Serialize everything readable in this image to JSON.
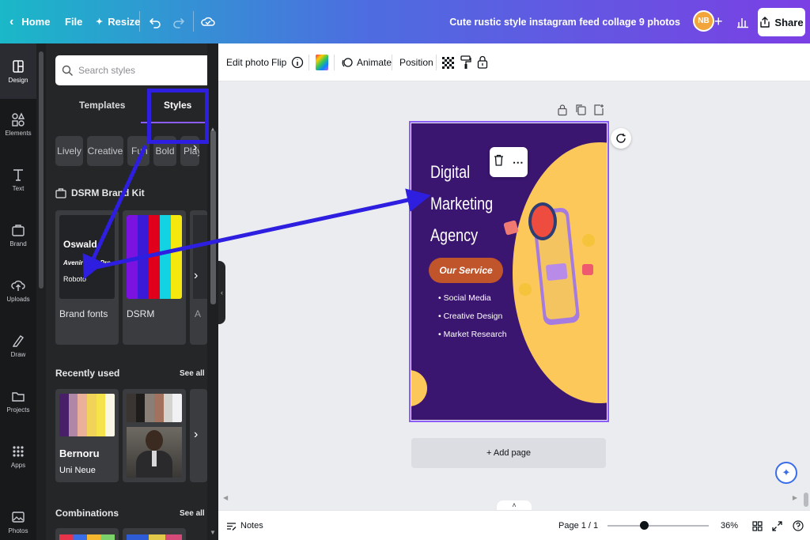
{
  "topbar": {
    "home_label": "Home",
    "file_label": "File",
    "resize_label": "Resize",
    "doc_title": "Cute rustic style instagram feed collage 9 photos",
    "avatar_initials": "NB",
    "share_label": "Share",
    "gradient_start": "#1ab8c8",
    "gradient_end": "#7b3fe4"
  },
  "rail": {
    "items": [
      {
        "label": "Design",
        "icon": "layout-icon"
      },
      {
        "label": "Elements",
        "icon": "shapes-icon"
      },
      {
        "label": "Text",
        "icon": "text-icon"
      },
      {
        "label": "Brand",
        "icon": "brand-icon"
      },
      {
        "label": "Uploads",
        "icon": "upload-icon"
      },
      {
        "label": "Draw",
        "icon": "pen-icon"
      },
      {
        "label": "Projects",
        "icon": "folder-icon"
      },
      {
        "label": "Apps",
        "icon": "grid-icon"
      },
      {
        "label": "Photos",
        "icon": "image-icon"
      }
    ]
  },
  "panel": {
    "search_placeholder": "Search styles",
    "tabs": {
      "templates": "Templates",
      "styles": "Styles"
    },
    "chips": [
      "Lively",
      "Creative",
      "Fun",
      "Bold",
      "Play"
    ],
    "brand_kit_title": "DSRM Brand Kit",
    "brand_fonts_label": "Brand fonts",
    "brand_fonts_preview": [
      "Oswald",
      "Avenir Next Pro",
      "Roboto"
    ],
    "dsrm_label": "DSRM",
    "dsrm_colors": [
      "#7b12e0",
      "#3a1ad6",
      "#e0001b",
      "#13d3e2",
      "#f5e80f"
    ],
    "third_card_label": "A",
    "recently_used_title": "Recently used",
    "see_all": "See all",
    "recent_card1_colors": [
      "#4a1f6a",
      "#b087a6",
      "#eab09a",
      "#f1d35a",
      "#f6e24a",
      "#f9f6e6"
    ],
    "recent_card1_font_a": "Bernoru",
    "recent_card1_font_b": "Uni Neue",
    "recent_card2_colors": [
      "#3a3532",
      "#1e1d1c",
      "#8a7f77",
      "#a3725e",
      "#d5d3d0",
      "#f1f1f3"
    ],
    "combinations_title": "Combinations",
    "combinations_see_all": "See all"
  },
  "toolbar": {
    "edit_photo": "Edit photo",
    "flip": "Flip",
    "animate": "Animate",
    "position": "Position"
  },
  "design": {
    "title_lines": [
      "Digital",
      "Marketing",
      "Agency"
    ],
    "service_badge": "Our Service",
    "bullets": [
      "Social Media",
      "Creative Design",
      "Market Research"
    ],
    "bg_color": "#3b1670",
    "accent_color": "#fdc85a",
    "badge_color": "#c0552b"
  },
  "canvas": {
    "add_page": "+ Add page"
  },
  "bottombar": {
    "notes": "Notes",
    "page_indicator": "Page 1 / 1",
    "zoom": "36%",
    "zoom_level": 0.36
  }
}
